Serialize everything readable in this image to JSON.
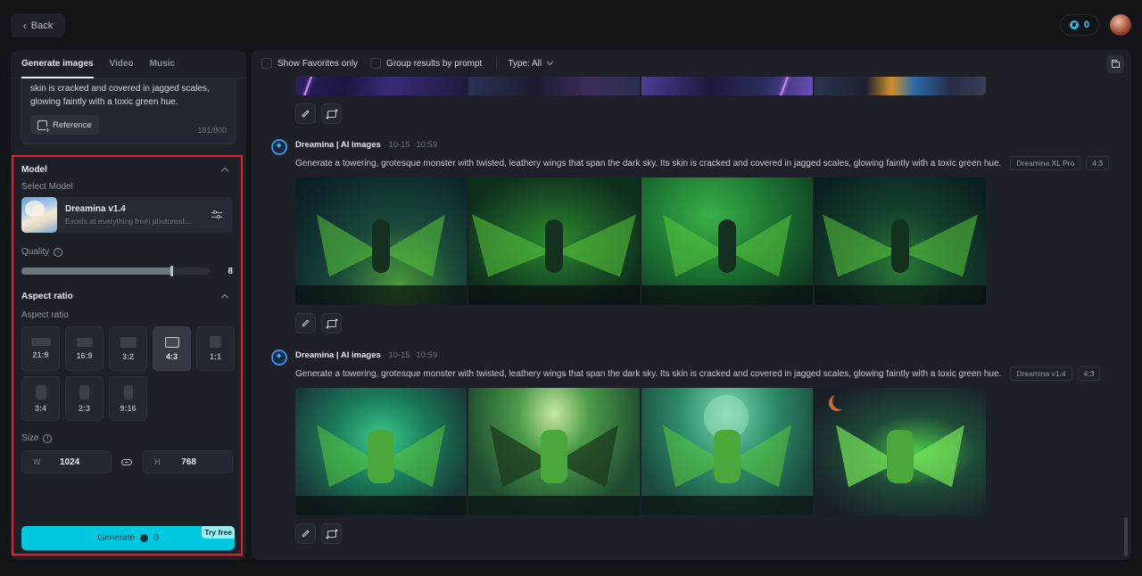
{
  "header": {
    "back_label": "Back",
    "credits": "0"
  },
  "left_panel": {
    "tabs": [
      {
        "label": "Generate images",
        "active": true
      },
      {
        "label": "Video",
        "active": false
      },
      {
        "label": "Music",
        "active": false
      }
    ],
    "prompt": {
      "visible_text": "skin is cracked and covered in jagged scales, glowing faintly with a toxic green hue.",
      "reference_label": "Reference",
      "char_count": "181/800"
    },
    "model_section": {
      "title": "Model",
      "select_label": "Select Model",
      "model_name": "Dreamina v1.4",
      "model_desc": "Excels at everything from photoreali..."
    },
    "quality": {
      "label": "Quality",
      "value": "8",
      "fraction": 0.8
    },
    "aspect_section": {
      "title": "Aspect ratio",
      "label": "Aspect ratio",
      "options": [
        {
          "label": "21:9",
          "selected": false
        },
        {
          "label": "16:9",
          "selected": false
        },
        {
          "label": "3:2",
          "selected": false
        },
        {
          "label": "4:3",
          "selected": true
        },
        {
          "label": "1:1",
          "selected": false
        },
        {
          "label": "3:4",
          "selected": false
        },
        {
          "label": "2:3",
          "selected": false
        },
        {
          "label": "9:16",
          "selected": false
        }
      ]
    },
    "size": {
      "label": "Size",
      "w_prefix": "W",
      "width": "1024",
      "h_prefix": "H",
      "height": "768"
    },
    "generate": {
      "label": "Generate",
      "cost": "0",
      "badge": "Try free"
    }
  },
  "main_panel": {
    "toolbar": {
      "favorites_label": "Show Favorites only",
      "group_label": "Group results by prompt",
      "type_label": "Type: All"
    },
    "generations": [
      {
        "source": "Dreamina | AI images",
        "date": "10-15",
        "time": "10:59",
        "prompt": "Generate a towering, grotesque monster with twisted, leathery wings that span the dark sky. Its skin is cracked and covered in jagged scales, glowing faintly with a toxic green hue.",
        "model_tag": "Dreamina XL Pro",
        "ratio_tag": "4:3"
      },
      {
        "source": "Dreamina | AI images",
        "date": "10-15",
        "time": "10:59",
        "prompt": "Generate a towering, grotesque monster with twisted, leathery wings that span the dark sky. Its skin is cracked and covered in jagged scales, glowing faintly with a toxic green hue.",
        "model_tag": "Dreamina v1.4",
        "ratio_tag": "4:3"
      }
    ]
  },
  "colors": {
    "accent": "#00c8de",
    "highlight_border": "#e5202e",
    "background": "#131418",
    "panel": "#1d2027"
  }
}
